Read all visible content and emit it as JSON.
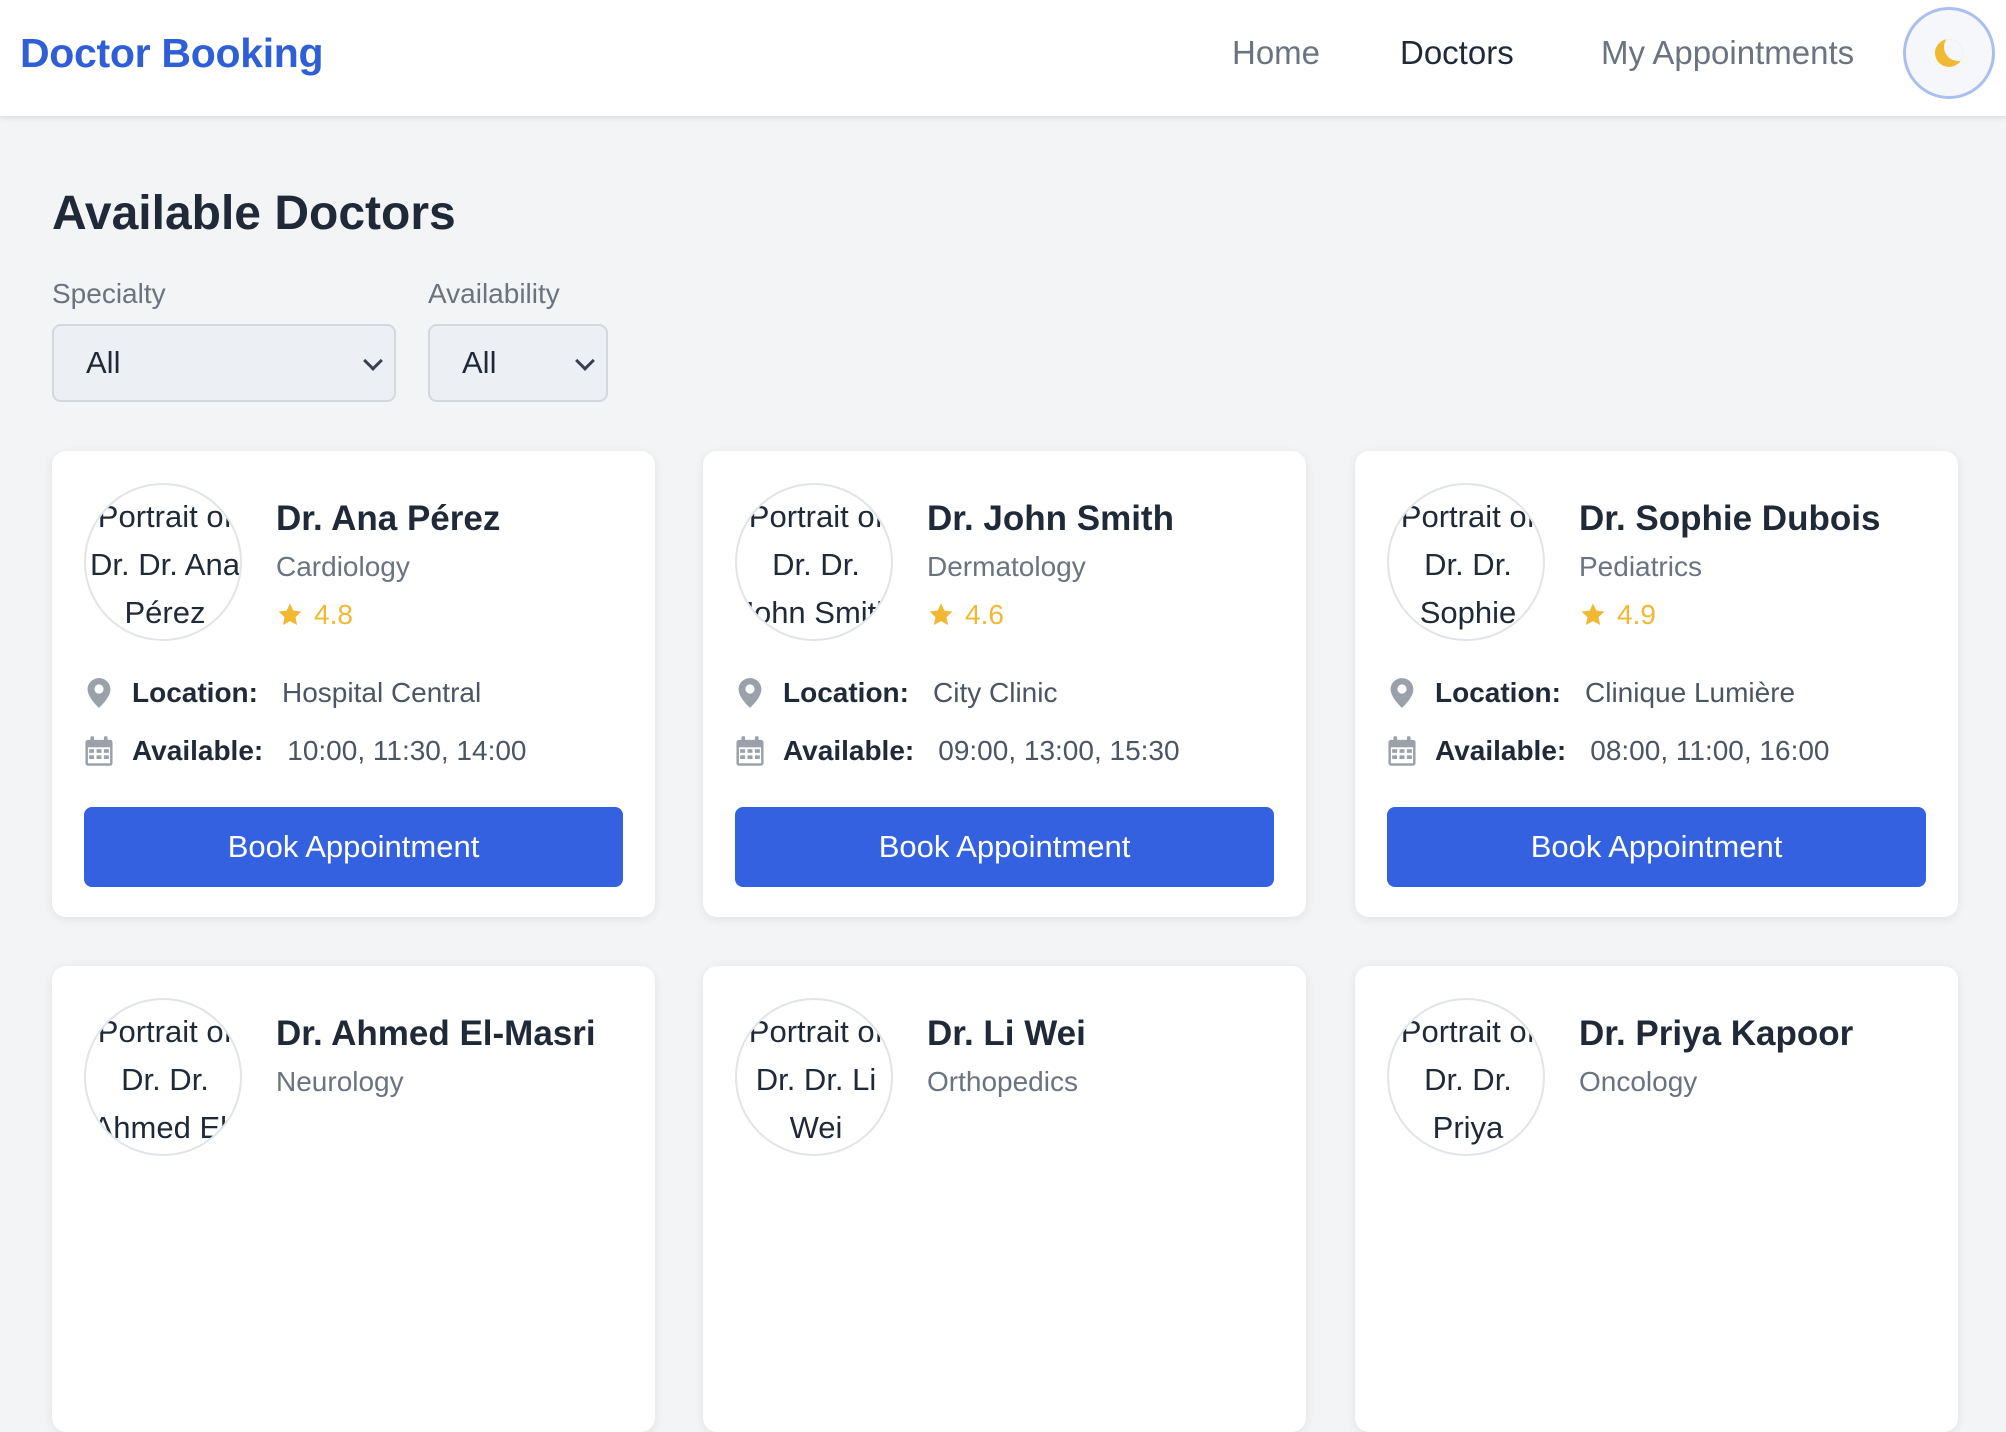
{
  "header": {
    "brand": "Doctor Booking",
    "nav": {
      "home": "Home",
      "doctors": "Doctors",
      "appointments": "My Appointments"
    },
    "theme_toggle_icon": "moon-icon"
  },
  "page": {
    "title": "Available Doctors"
  },
  "filters": {
    "specialty": {
      "label": "Specialty",
      "value": "All"
    },
    "availability": {
      "label": "Availability",
      "value": "All"
    }
  },
  "labels": {
    "location": "Location:",
    "available": "Available:",
    "book": "Book Appointment"
  },
  "colors": {
    "brand": "#2f5fd6",
    "button": "#3461e0",
    "star": "#f1b832",
    "background": "#f3f4f6"
  },
  "doctors": [
    {
      "avatar_alt": "Portrait of Dr. Dr. Ana Pérez",
      "name": "Dr. Ana Pérez",
      "specialty": "Cardiology",
      "rating": "4.8",
      "location": "Hospital Central",
      "available": "10:00, 11:30, 14:00"
    },
    {
      "avatar_alt": "Portrait of Dr. Dr. John Smith",
      "name": "Dr. John Smith",
      "specialty": "Dermatology",
      "rating": "4.6",
      "location": "City Clinic",
      "available": "09:00, 13:00, 15:30"
    },
    {
      "avatar_alt": "Portrait of Dr. Dr. Sophie Dubois",
      "name": "Dr. Sophie Dubois",
      "specialty": "Pediatrics",
      "rating": "4.9",
      "location": "Clinique Lumière",
      "available": "08:00, 11:00, 16:00"
    },
    {
      "avatar_alt": "Portrait of Dr. Dr. Ahmed El-Masri",
      "name": "Dr. Ahmed El-Masri",
      "specialty": "Neurology"
    },
    {
      "avatar_alt": "Portrait of Dr. Dr. Li Wei",
      "name": "Dr. Li Wei",
      "specialty": "Orthopedics"
    },
    {
      "avatar_alt": "Portrait of Dr. Dr. Priya Kapoor",
      "name": "Dr. Priya Kapoor",
      "specialty": "Oncology"
    }
  ]
}
